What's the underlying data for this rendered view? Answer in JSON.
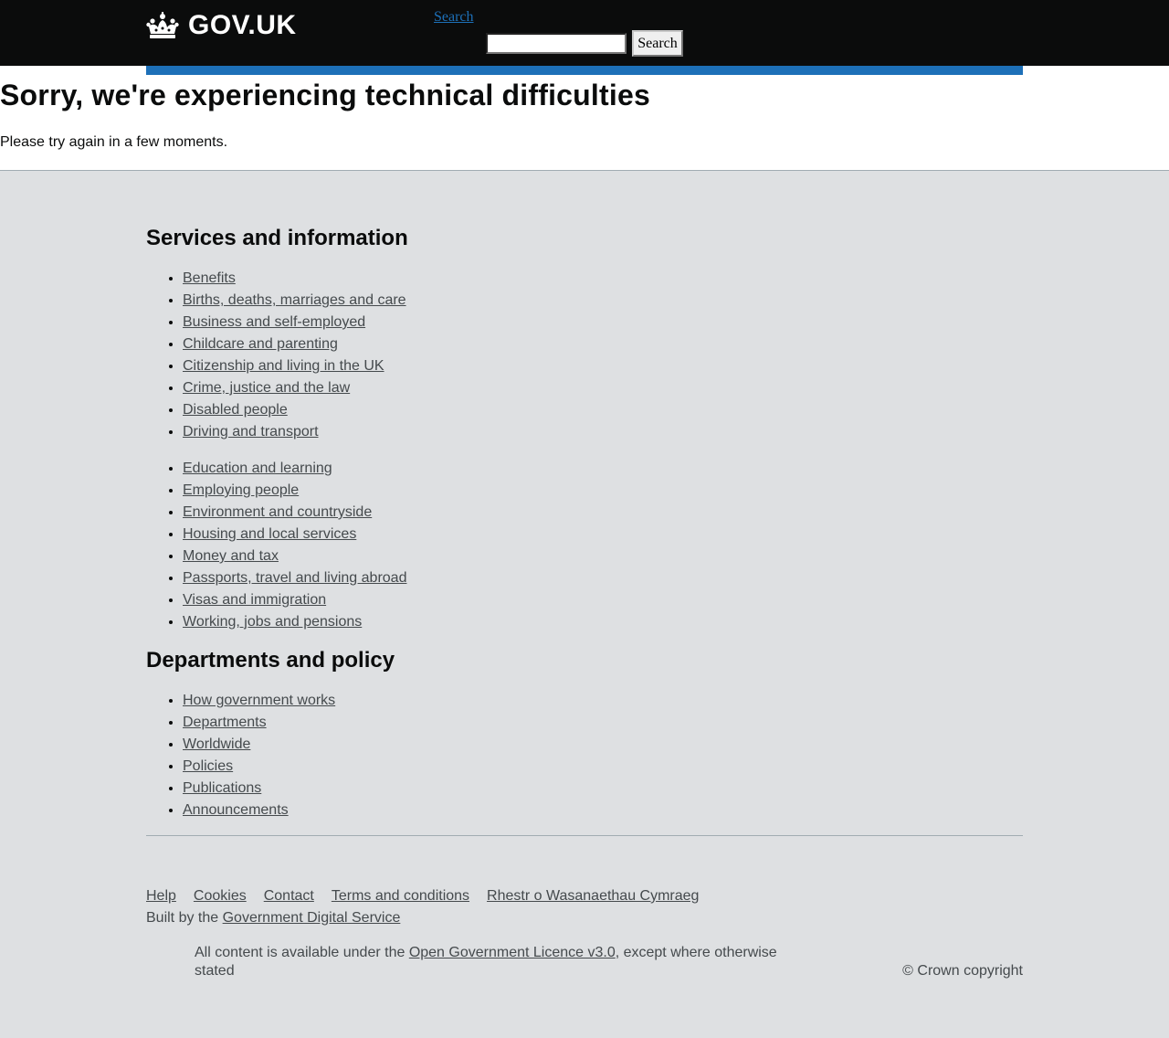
{
  "header": {
    "logo_text": "GOV.UK",
    "search_link": "Search",
    "search_value": "",
    "search_button": "Search"
  },
  "main": {
    "title": "Sorry, we're experiencing technical difficulties",
    "body": "Please try again in a few moments."
  },
  "footer": {
    "services": {
      "heading": "Services and information",
      "column1": [
        "Benefits",
        "Births, deaths, marriages and care",
        "Business and self-employed",
        "Childcare and parenting",
        "Citizenship and living in the UK",
        "Crime, justice and the law",
        "Disabled people",
        "Driving and transport"
      ],
      "column2": [
        "Education and learning",
        "Employing people",
        "Environment and countryside",
        "Housing and local services",
        "Money and tax",
        "Passports, travel and living abroad",
        "Visas and immigration",
        "Working, jobs and pensions"
      ]
    },
    "departments": {
      "heading": "Departments and policy",
      "items": [
        "How government works",
        "Departments",
        "Worldwide",
        "Policies",
        "Publications",
        "Announcements"
      ]
    },
    "meta_links": [
      "Help",
      "Cookies",
      "Contact",
      "Terms and conditions",
      "Rhestr o Wasanaethau Cymraeg"
    ],
    "built_by_prefix": "Built by the ",
    "built_by_link": "Government Digital Service",
    "licence_prefix": "All content is available under the ",
    "licence_link": "Open Government Licence v3.0",
    "licence_suffix": ", except where otherwise stated",
    "copyright": "© Crown copyright"
  },
  "colors": {
    "header_bg": "#0b0c0c",
    "accent_blue": "#1d70b8",
    "footer_bg": "#dee0e2",
    "link_grey": "#454a4d"
  },
  "icons": {
    "logo": "crown-icon"
  }
}
